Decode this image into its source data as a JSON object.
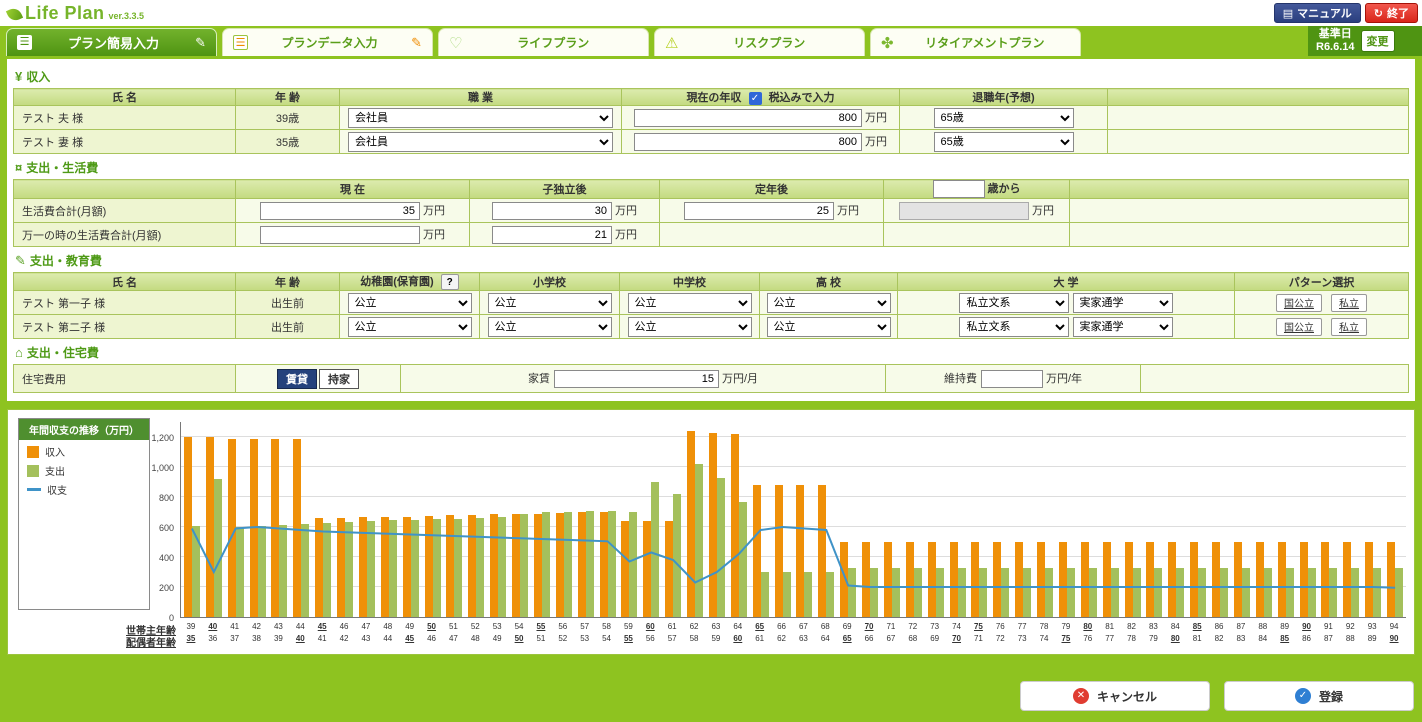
{
  "header": {
    "logo_title": "Life Plan",
    "logo_version": "ver.3.3.5",
    "manual_button": "マニュアル",
    "exit_button": "終了"
  },
  "tab_bar": {
    "tabs": [
      {
        "label": "プラン簡易入力"
      },
      {
        "label": "プランデータ入力"
      },
      {
        "label": "ライフプラン"
      },
      {
        "label": "リスクプラン"
      },
      {
        "label": "リタイアメントプラン"
      }
    ],
    "base_date_label": "基準日",
    "base_date_value": "R6.6.14",
    "change_button": "変更"
  },
  "income": {
    "title": "収入",
    "col_name": "氏 名",
    "col_age": "年 齢",
    "col_job": "職 業",
    "col_salary": "現在の年収",
    "tax_checkbox_label": "税込みで入力",
    "col_retire": "退職年(予想)",
    "unit_man_yen": "万円",
    "rows": [
      {
        "name": "テスト 夫 様",
        "age": "39歳",
        "job": "会社員",
        "salary": "800",
        "retire": "65歳"
      },
      {
        "name": "テスト 妻 様",
        "age": "35歳",
        "job": "会社員",
        "salary": "800",
        "retire": "65歳"
      }
    ]
  },
  "living": {
    "title": "支出・生活費",
    "col_current": "現 在",
    "col_after_children": "子独立後",
    "col_after_retire": "定年後",
    "from_age_suffix": "歳から",
    "from_age_value": "",
    "unit": "万円",
    "row1_label": "生活費合計(月額)",
    "row1_current": "35",
    "row1_after_children": "30",
    "row1_after_retire": "25",
    "row1_from_age": "",
    "row2_label": "万一の時の生活費合計(月額)",
    "row2_current": "",
    "row2_after_children": "21"
  },
  "education": {
    "title": "支出・教育費",
    "col_name": "氏 名",
    "col_age": "年 齢",
    "col_kindergarten": "幼稚園(保育園)",
    "help_button": "?",
    "col_elementary": "小学校",
    "col_junior": "中学校",
    "col_high": "高 校",
    "col_univ": "大 学",
    "col_pattern": "パターン選択",
    "rows": [
      {
        "name": "テスト 第一子 様",
        "age": "出生前",
        "kindergarten": "公立",
        "elementary": "公立",
        "junior": "公立",
        "high": "公立",
        "univ_type": "私立文系",
        "univ_commute": "実家通学",
        "pattern_national": "国公立",
        "pattern_private": "私立"
      },
      {
        "name": "テスト 第二子 様",
        "age": "出生前",
        "kindergarten": "公立",
        "elementary": "公立",
        "junior": "公立",
        "high": "公立",
        "univ_type": "私立文系",
        "univ_commute": "実家通学",
        "pattern_national": "国公立",
        "pattern_private": "私立"
      }
    ]
  },
  "housing": {
    "title": "支出・住宅費",
    "row_label": "住宅費用",
    "rent_button": "賃貸",
    "own_button": "持家",
    "rent_field_label": "家賃",
    "rent_value": "15",
    "rent_unit": "万円/月",
    "maintenance_label": "維持費",
    "maintenance_value": "",
    "maintenance_unit": "万円/年"
  },
  "chart_data": {
    "type": "bar",
    "subtype": "grouped bars with line overlay",
    "title": "年間収支の推移（万円）",
    "legend": [
      "収入",
      "支出",
      "収支"
    ],
    "legend_position": "left",
    "grid": true,
    "colors": {
      "income": "#ef9008",
      "expense": "#a4c05c",
      "balance": "#3f93c8"
    },
    "ylim": [
      0,
      1300
    ],
    "y_ticks": [
      0,
      200,
      400,
      600,
      800,
      1000,
      1200
    ],
    "x_axis": {
      "row1_label": "世帯主年齢",
      "row2_label": "配偶者年齢",
      "head_ages": [
        39,
        40,
        41,
        42,
        43,
        44,
        45,
        46,
        47,
        48,
        49,
        50,
        51,
        52,
        53,
        54,
        55,
        56,
        57,
        58,
        59,
        60,
        61,
        62,
        63,
        64,
        65,
        66,
        67,
        68,
        69,
        70,
        71,
        72,
        73,
        74,
        75,
        76,
        77,
        78,
        79,
        80,
        81,
        82,
        83,
        84,
        85,
        86,
        87,
        88,
        89,
        90,
        91,
        92,
        93,
        94
      ],
      "spouse_ages": [
        35,
        36,
        37,
        38,
        39,
        40,
        41,
        42,
        43,
        44,
        45,
        46,
        47,
        48,
        49,
        50,
        51,
        52,
        53,
        54,
        55,
        56,
        57,
        58,
        59,
        60,
        61,
        62,
        63,
        64,
        65,
        66,
        67,
        68,
        69,
        70,
        71,
        72,
        73,
        74,
        75,
        76,
        77,
        78,
        79,
        80,
        81,
        82,
        83,
        84,
        85,
        86,
        87,
        88,
        89,
        90
      ]
    },
    "series": [
      {
        "name": "収入",
        "values": [
          1200,
          1200,
          1190,
          1190,
          1190,
          1190,
          660,
          660,
          665,
          670,
          670,
          675,
          680,
          680,
          685,
          690,
          690,
          695,
          700,
          700,
          640,
          640,
          640,
          1240,
          1230,
          1220,
          880,
          880,
          880,
          880,
          500,
          500,
          500,
          500,
          500,
          500,
          500,
          500,
          500,
          500,
          500,
          500,
          500,
          500,
          500,
          500,
          500,
          500,
          500,
          500,
          500,
          500,
          500,
          500,
          500,
          500
        ]
      },
      {
        "name": "支出",
        "values": [
          610,
          920,
          600,
          610,
          615,
          620,
          630,
          635,
          640,
          645,
          650,
          655,
          655,
          660,
          665,
          690,
          700,
          700,
          710,
          710,
          700,
          900,
          820,
          1020,
          930,
          770,
          300,
          300,
          300,
          300,
          330,
          330,
          330,
          330,
          330,
          330,
          330,
          330,
          330,
          330,
          330,
          330,
          330,
          330,
          330,
          330,
          330,
          330,
          330,
          330,
          330,
          330,
          330,
          330,
          330,
          330
        ]
      },
      {
        "name": "収支",
        "values": [
          590,
          300,
          590,
          600,
          590,
          580,
          570,
          565,
          560,
          555,
          550,
          545,
          540,
          535,
          530,
          525,
          520,
          515,
          510,
          505,
          370,
          430,
          380,
          230,
          300,
          420,
          580,
          600,
          590,
          580,
          210,
          200,
          200,
          200,
          200,
          200,
          200,
          200,
          200,
          200,
          200,
          200,
          200,
          200,
          200,
          200,
          200,
          200,
          200,
          200,
          200,
          200,
          200,
          200,
          200,
          195
        ]
      }
    ]
  },
  "footer": {
    "cancel_button": "キャンセル",
    "register_button": "登録"
  }
}
